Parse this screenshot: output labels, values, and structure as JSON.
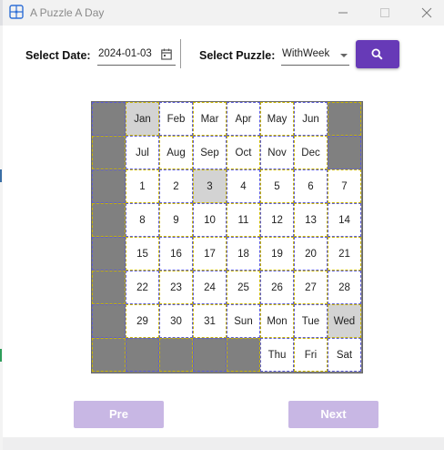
{
  "window": {
    "title": "A Puzzle A Day",
    "icon": "puzzle-icon"
  },
  "toolbar": {
    "date_label": "Select Date:",
    "date_value": "2024-01-03",
    "puzzle_label": "Select Puzzle:",
    "puzzle_value": "WithWeek",
    "search_icon": "search-icon",
    "accent_color": "#673ab7"
  },
  "board": {
    "rows": [
      [
        {
          "t": "",
          "k": "empty"
        },
        {
          "t": "Jan",
          "k": "sel"
        },
        {
          "t": "Feb",
          "k": "open"
        },
        {
          "t": "Mar",
          "k": "open"
        },
        {
          "t": "Apr",
          "k": "open"
        },
        {
          "t": "May",
          "k": "open"
        },
        {
          "t": "Jun",
          "k": "open"
        },
        {
          "t": "",
          "k": "empty"
        }
      ],
      [
        {
          "t": "",
          "k": "empty"
        },
        {
          "t": "Jul",
          "k": "open"
        },
        {
          "t": "Aug",
          "k": "open"
        },
        {
          "t": "Sep",
          "k": "open"
        },
        {
          "t": "Oct",
          "k": "open"
        },
        {
          "t": "Nov",
          "k": "open"
        },
        {
          "t": "Dec",
          "k": "open"
        },
        {
          "t": "",
          "k": "empty"
        }
      ],
      [
        {
          "t": "",
          "k": "empty"
        },
        {
          "t": "1",
          "k": "open"
        },
        {
          "t": "2",
          "k": "open"
        },
        {
          "t": "3",
          "k": "sel"
        },
        {
          "t": "4",
          "k": "open"
        },
        {
          "t": "5",
          "k": "open"
        },
        {
          "t": "6",
          "k": "open"
        },
        {
          "t": "7",
          "k": "open"
        }
      ],
      [
        {
          "t": "",
          "k": "empty"
        },
        {
          "t": "8",
          "k": "open"
        },
        {
          "t": "9",
          "k": "open"
        },
        {
          "t": "10",
          "k": "open"
        },
        {
          "t": "11",
          "k": "open"
        },
        {
          "t": "12",
          "k": "open"
        },
        {
          "t": "13",
          "k": "open"
        },
        {
          "t": "14",
          "k": "open"
        }
      ],
      [
        {
          "t": "",
          "k": "empty"
        },
        {
          "t": "15",
          "k": "open"
        },
        {
          "t": "16",
          "k": "open"
        },
        {
          "t": "17",
          "k": "open"
        },
        {
          "t": "18",
          "k": "open"
        },
        {
          "t": "19",
          "k": "open"
        },
        {
          "t": "20",
          "k": "open"
        },
        {
          "t": "21",
          "k": "open"
        }
      ],
      [
        {
          "t": "",
          "k": "empty"
        },
        {
          "t": "22",
          "k": "open"
        },
        {
          "t": "23",
          "k": "open"
        },
        {
          "t": "24",
          "k": "open"
        },
        {
          "t": "25",
          "k": "open"
        },
        {
          "t": "26",
          "k": "open"
        },
        {
          "t": "27",
          "k": "open"
        },
        {
          "t": "28",
          "k": "open"
        }
      ],
      [
        {
          "t": "",
          "k": "empty"
        },
        {
          "t": "29",
          "k": "open"
        },
        {
          "t": "30",
          "k": "open"
        },
        {
          "t": "31",
          "k": "open"
        },
        {
          "t": "Sun",
          "k": "open"
        },
        {
          "t": "Mon",
          "k": "open"
        },
        {
          "t": "Tue",
          "k": "open"
        },
        {
          "t": "Wed",
          "k": "sel"
        }
      ],
      [
        {
          "t": "",
          "k": "empty"
        },
        {
          "t": "",
          "k": "empty"
        },
        {
          "t": "",
          "k": "empty"
        },
        {
          "t": "",
          "k": "empty"
        },
        {
          "t": "",
          "k": "empty"
        },
        {
          "t": "Thu",
          "k": "open"
        },
        {
          "t": "Fri",
          "k": "open"
        },
        {
          "t": "Sat",
          "k": "open"
        }
      ]
    ],
    "selected_color": "#d3d3d3",
    "empty_color": "#808080"
  },
  "nav": {
    "prev_label": "Pre",
    "next_label": "Next",
    "button_color": "#c8b7e4"
  }
}
